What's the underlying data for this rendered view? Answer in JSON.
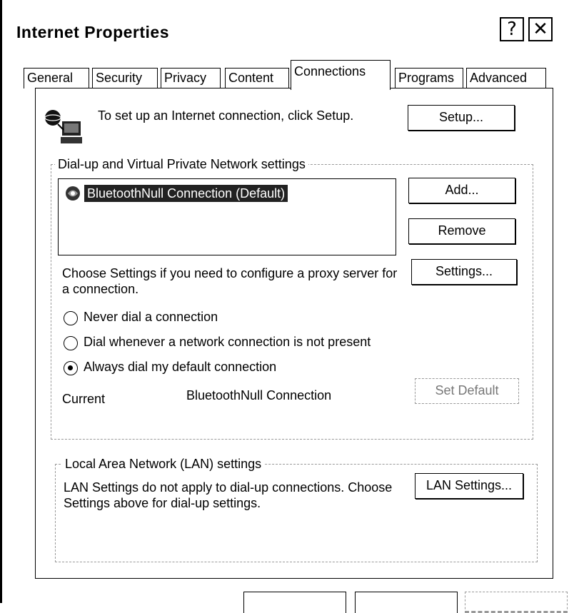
{
  "window": {
    "title": "Internet Properties",
    "help_glyph": "?",
    "close_glyph": "✕"
  },
  "tabs": [
    {
      "label": "General"
    },
    {
      "label": "Security"
    },
    {
      "label": "Privacy"
    },
    {
      "label": "Content"
    },
    {
      "label": "Connections"
    },
    {
      "label": "Programs"
    },
    {
      "label": "Advanced"
    }
  ],
  "active_tab": "Connections",
  "setup": {
    "text": "To set up an Internet connection, click Setup.",
    "button": "Setup..."
  },
  "dialup": {
    "group_label": "Dial-up and Virtual Private Network settings",
    "connections": [
      {
        "name": "BluetoothNull Connection (Default)",
        "selected": true
      }
    ],
    "add_button": "Add...",
    "remove_button": "Remove",
    "proxy_text": "Choose Settings if you need to configure a proxy server for a connection.",
    "settings_button": "Settings...",
    "options": [
      {
        "label": "Never dial a connection",
        "checked": false
      },
      {
        "label": "Dial whenever a network connection is not present",
        "checked": false
      },
      {
        "label": "Always dial my default connection",
        "checked": true
      }
    ],
    "current_label": "Current",
    "current_value": "BluetoothNull Connection",
    "set_default_button": "Set Default"
  },
  "lan": {
    "group_label": "Local Area Network (LAN) settings",
    "text": "LAN Settings do not apply to dial-up connections. Choose Settings above for dial-up settings.",
    "button": "LAN Settings..."
  }
}
